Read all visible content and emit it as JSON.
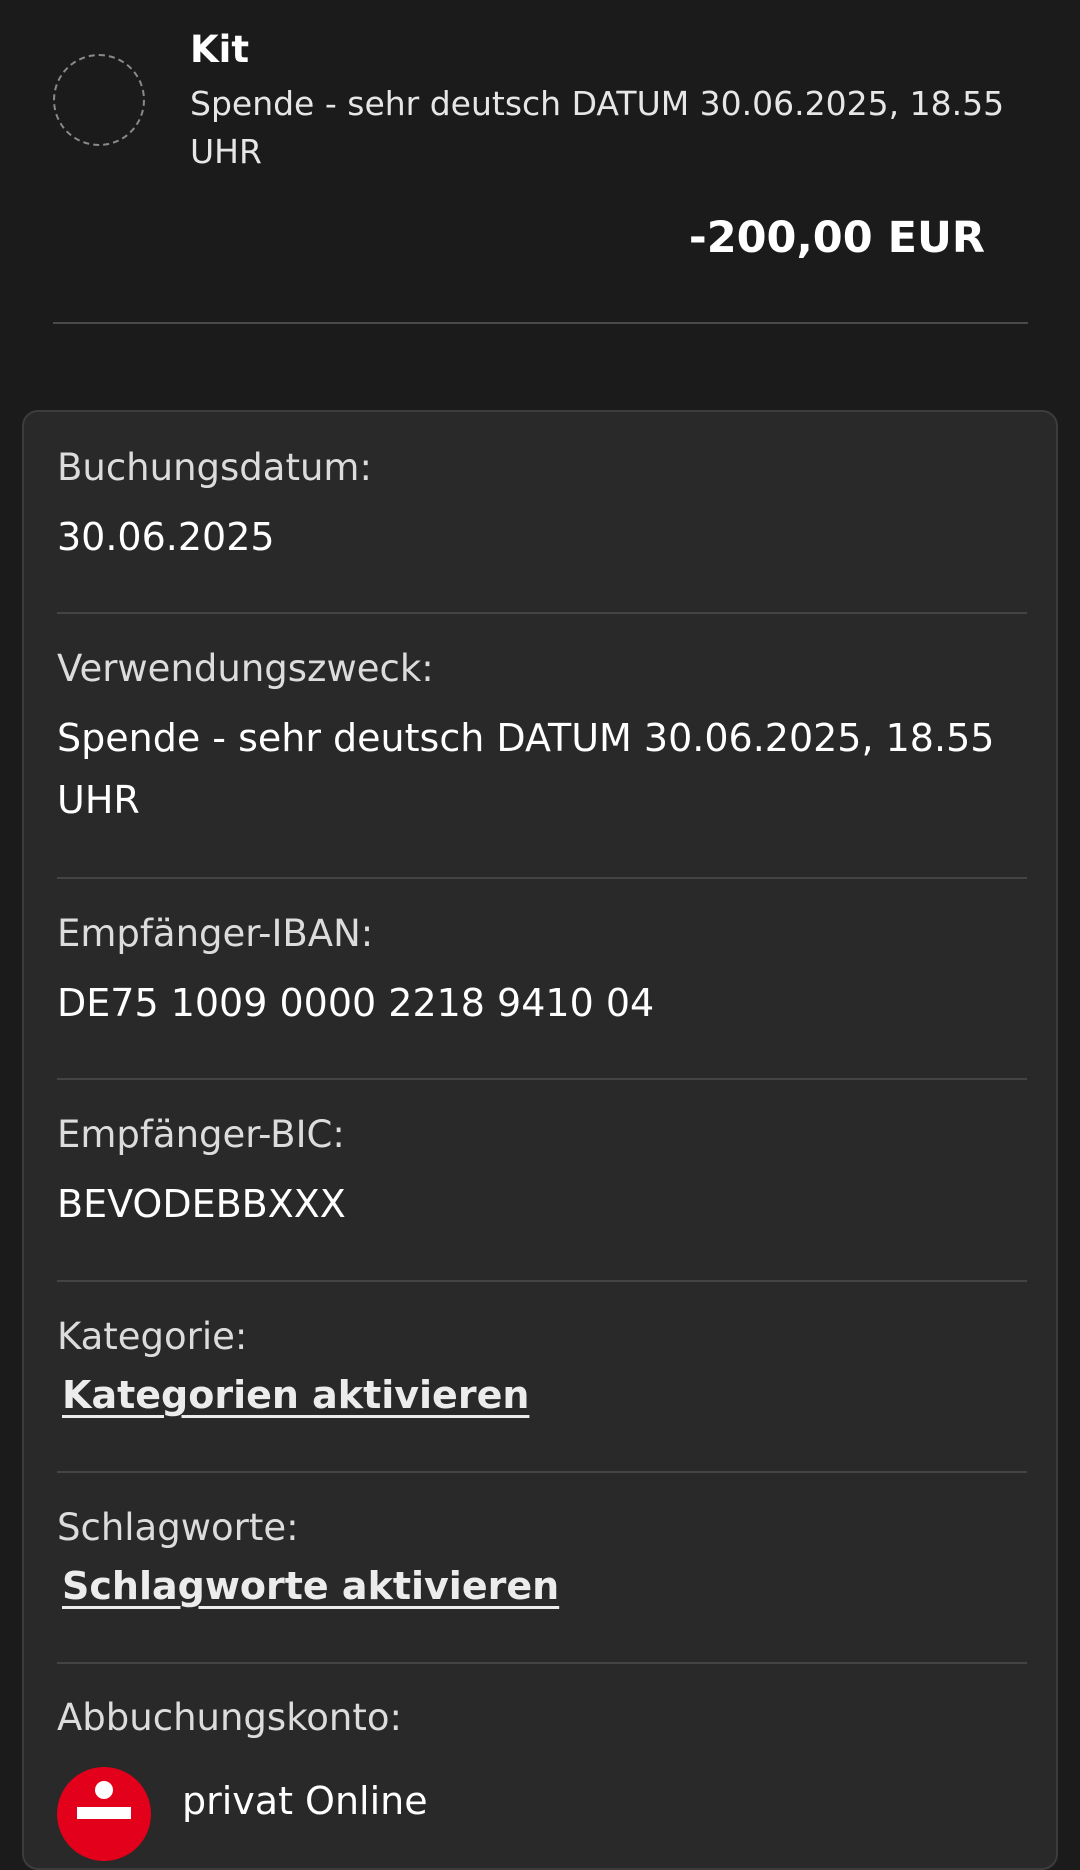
{
  "transaction": {
    "name": "Kit",
    "purpose": "Spende - sehr deutsch DATUM 30.06.2025, 18.55 UHR",
    "amount": "-200,00 EUR"
  },
  "details": {
    "booking_date_label": "Buchungsdatum:",
    "booking_date_value": "30.06.2025",
    "purpose_label": "Verwendungszweck:",
    "purpose_value": "Spende - sehr deutsch DATUM 30.06.2025, 18.55 UHR",
    "iban_label": "Empfänger-IBAN:",
    "iban_value": "DE75 1009 0000 2218 9410 04",
    "bic_label": "Empfänger-BIC:",
    "bic_value": "BEVODEBBXXX",
    "category_label": "Kategorie:",
    "category_link": "Kategorien aktivieren",
    "tags_label": "Schlagworte:",
    "tags_link": "Schlagworte aktivieren",
    "debit_account_label": "Abbuchungskonto:",
    "debit_account_name": "privat Online"
  },
  "colors": {
    "background": "#1b1b1b",
    "card": "#292929",
    "bank_brand": "#e2001a"
  },
  "icons": {
    "payee_avatar": "dashed-circle-placeholder",
    "bank_logo": "sparkasse-logo-icon"
  }
}
